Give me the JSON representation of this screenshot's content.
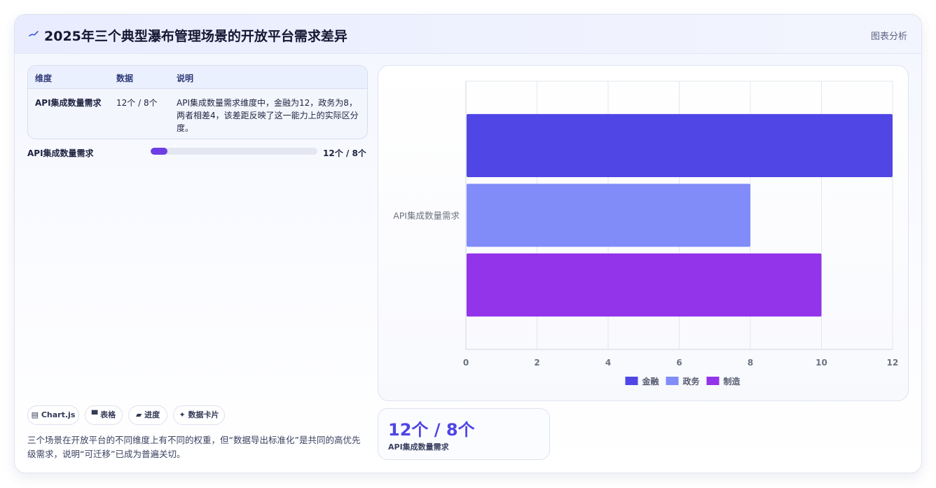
{
  "header": {
    "title": "2025年三个典型瀑布管理场景的开放平台需求差异",
    "link_label": "图表分析",
    "logo_icon": "pulse-line-icon"
  },
  "table": {
    "headers": [
      "维度",
      "数据",
      "说明"
    ],
    "rows": [
      {
        "dimension": "API集成数量需求",
        "data": "12个 / 8个",
        "desc_lines": [
          "API集成数量需求维度中，金融为12，政务为8，",
          "两者相差4，该差距反映了这一能力上的实际区分",
          "度。"
        ]
      }
    ]
  },
  "progress": {
    "label": "API集成数量需求",
    "value_text": "12个 / 8个",
    "fill_fraction": 0.1,
    "color": "#6d3ee6"
  },
  "chips": [
    {
      "icon": "chart-icon",
      "glyph": "▤",
      "label": "Chart.js"
    },
    {
      "icon": "table-icon",
      "glyph": "▀",
      "label": "表格"
    },
    {
      "icon": "progress-icon",
      "glyph": "▰",
      "label": "进度"
    },
    {
      "icon": "sparkle-icon",
      "glyph": "✦",
      "label": "数据卡片"
    }
  ],
  "note": "三个场景在开放平台的不同维度上有不同的权重，但“数据导出标准化”是共同的高优先级需求，说明“可迁移”已成为普遍关切。",
  "stat": {
    "value": "12个 / 8个",
    "label": "API集成数量需求"
  },
  "chart_data": {
    "type": "bar",
    "orientation": "horizontal",
    "categories": [
      "API集成数量需求"
    ],
    "series": [
      {
        "name": "金融",
        "values": [
          12
        ],
        "color": "#4f46e5"
      },
      {
        "name": "政务",
        "values": [
          8
        ],
        "color": "#818cf8"
      },
      {
        "name": "制造",
        "values": [
          10
        ],
        "color": "#9333ea"
      }
    ],
    "xlim": [
      0,
      12
    ],
    "xticks": [
      0,
      2,
      4,
      6,
      8,
      10,
      12
    ],
    "grid": true,
    "legend": "bottom"
  }
}
